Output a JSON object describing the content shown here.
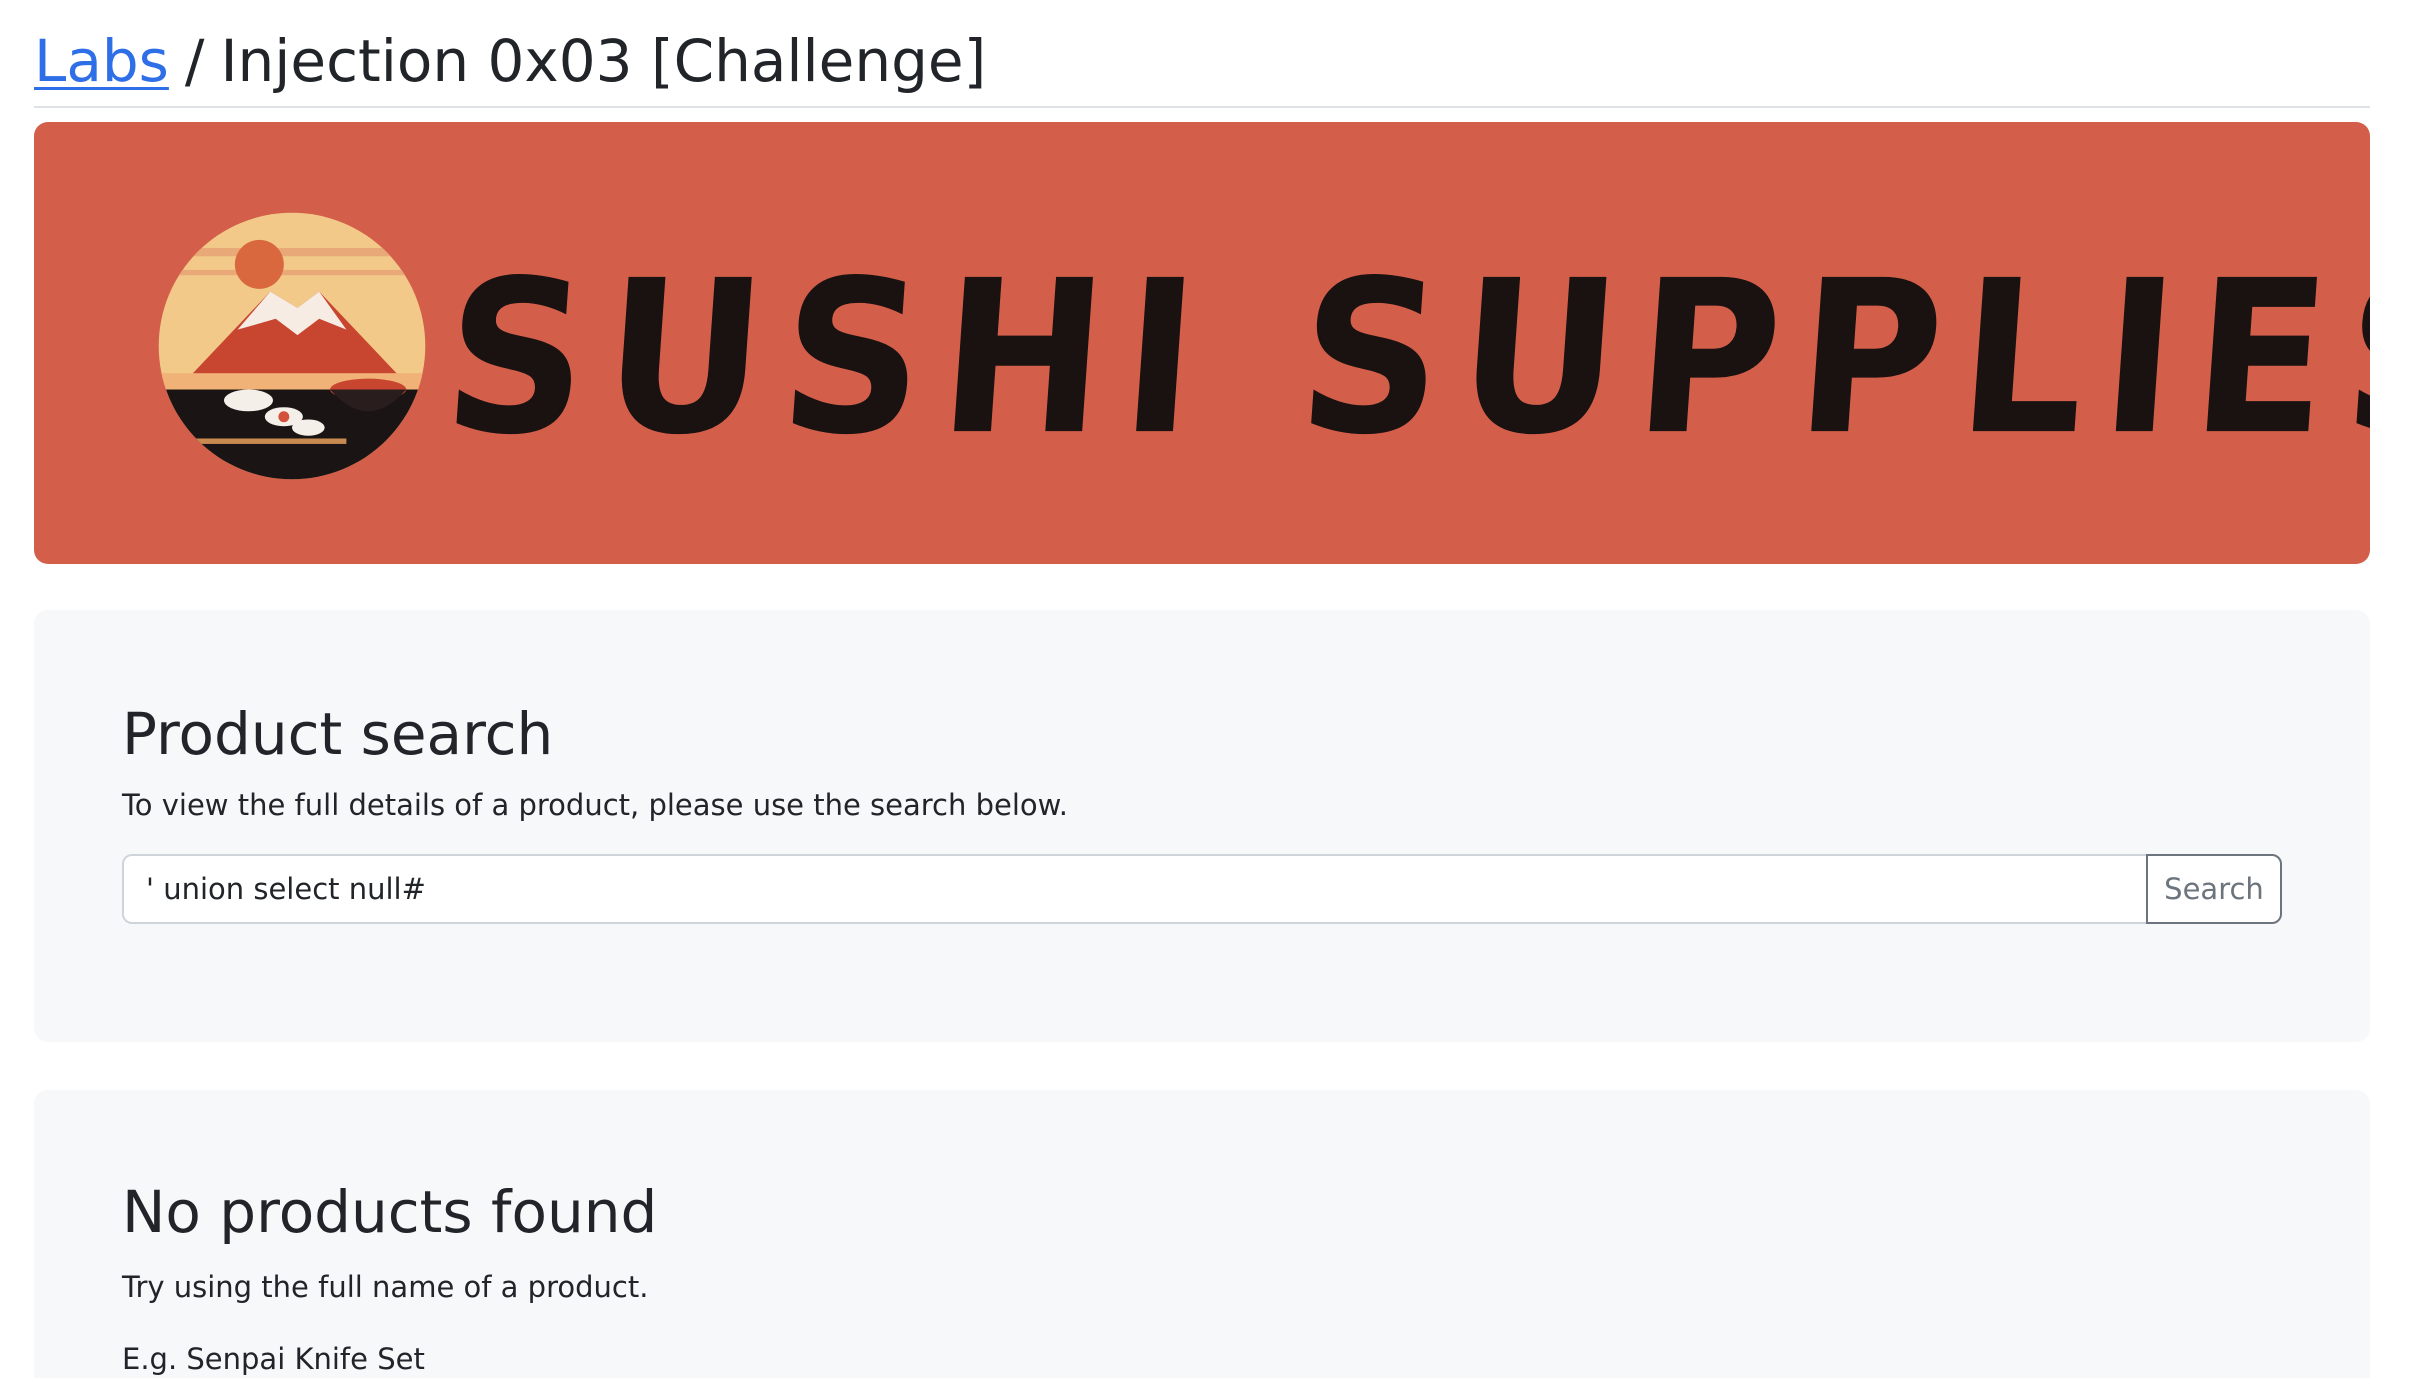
{
  "breadcrumb": {
    "root_link": "Labs",
    "separator": "/",
    "current": "Injection 0x03 [Challenge]"
  },
  "banner": {
    "brand_text": "SUSHI SUPPLIES",
    "background_color": "#d35f4a",
    "logo_icon": "mountain-sushi-logo-icon"
  },
  "search": {
    "title": "Product search",
    "description": "To view the full details of a product, please use the search below.",
    "input_value": "' union select null#",
    "button_label": "Search"
  },
  "results": {
    "title": "No products found",
    "hint": "Try using the full name of a product.",
    "example": "E.g. Senpai Knife Set"
  },
  "colors": {
    "link": "#2e6ee6",
    "card_background": "#f7f8fa"
  }
}
